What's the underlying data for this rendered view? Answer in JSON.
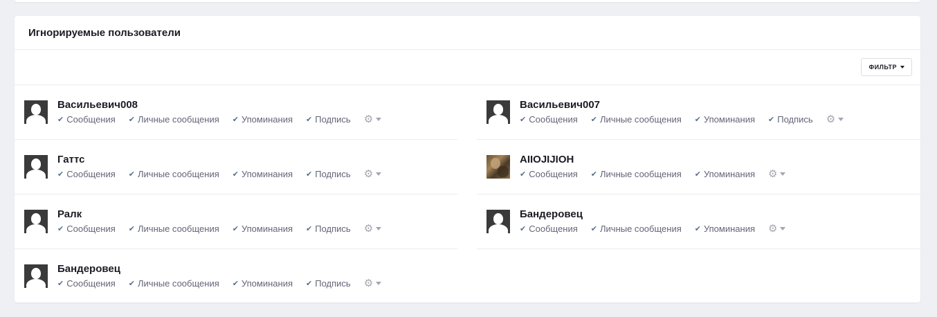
{
  "panel": {
    "title": "Игнорируемые пользователи",
    "filter_label": "ФИЛЬТР"
  },
  "options": {
    "messages": "Сообщения",
    "personal_messages": "Личные сообщения",
    "mentions": "Упоминания",
    "signature": "Подпись"
  },
  "icons": {
    "check": "check-icon",
    "gear": "gear-icon",
    "caret": "caret-down-icon"
  },
  "left_users": [
    {
      "name": "Васильевич008"
    },
    {
      "name": "Гаттс"
    },
    {
      "name": "Ралк"
    },
    {
      "name": "Бандеровец"
    }
  ],
  "right_users": [
    {
      "name": "Васильевич007"
    },
    {
      "name": "AIIOJIJIOH"
    },
    {
      "name": "Бандеровец"
    }
  ]
}
